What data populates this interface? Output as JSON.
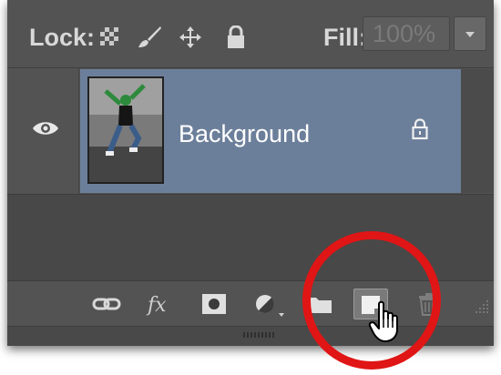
{
  "lock_bar": {
    "lock_label": "Lock:",
    "fill_label": "Fill:",
    "fill_value": "100%",
    "icons": [
      "lock-transparent-pixels-icon",
      "lock-image-pixels-icon",
      "lock-position-icon",
      "lock-all-icon"
    ]
  },
  "layer": {
    "name": "Background",
    "visible": true,
    "locked": true,
    "selected_color": "#6c7f9a"
  },
  "footer": {
    "buttons": [
      "link-layers-icon",
      "fx-icon",
      "layer-mask-icon",
      "adjustment-layer-icon",
      "folder-icon",
      "new-layer-icon",
      "trash-icon"
    ],
    "fx_label": "fx",
    "highlighted_button": "new-layer-icon"
  },
  "colors": {
    "panel": "#535353",
    "highlight_circle": "#e01515",
    "selected_layer": "#6c7f9a"
  }
}
